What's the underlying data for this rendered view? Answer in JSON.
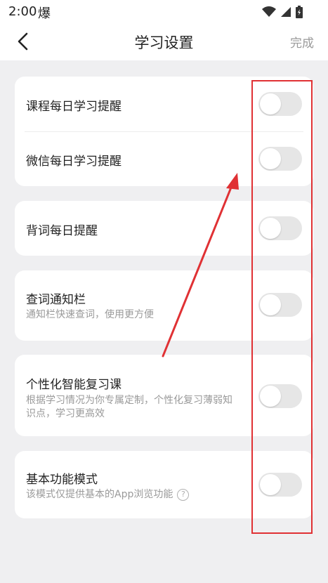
{
  "status_bar": {
    "time": "2:00",
    "extra": "爆"
  },
  "nav": {
    "title": "学习设置",
    "done_label": "完成",
    "back_icon": "chevron-left-icon"
  },
  "settings": {
    "course_reminder": {
      "title": "课程每日学习提醒",
      "enabled": false
    },
    "wechat_reminder": {
      "title": "微信每日学习提醒",
      "enabled": false
    },
    "vocab_reminder": {
      "title": "背词每日提醒",
      "enabled": false
    },
    "lookup_bar": {
      "title": "查词通知栏",
      "desc": "通知栏快速查词，使用更方便",
      "enabled": false
    },
    "personalized_review": {
      "title": "个性化智能复习课",
      "desc": "根据学习情况为你专属定制，个性化复习薄弱知识点，学习更高效",
      "enabled": false
    },
    "basic_mode": {
      "title": "基本功能模式",
      "desc": "该模式仅提供基本的App浏览功能",
      "enabled": false,
      "help_icon": "question-circle-icon"
    }
  },
  "colors": {
    "annotation": "#e03134",
    "background": "#efeff1",
    "toggle_off": "#e6e6e6",
    "muted_text": "#9a9a9a"
  }
}
